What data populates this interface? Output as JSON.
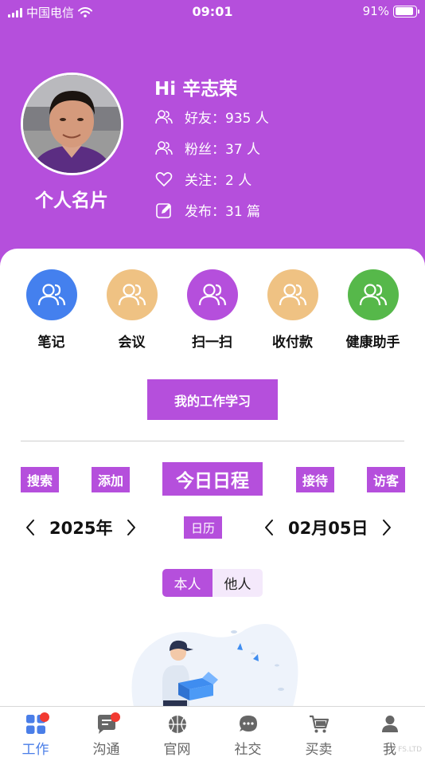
{
  "status_bar": {
    "carrier": "中国电信",
    "time": "09:01",
    "battery": "91%",
    "battery_level": 0.91
  },
  "profile": {
    "greeting": "Hi 辛志荣",
    "card_title": "个人名片",
    "stats": [
      {
        "label": "好友：935 人",
        "icon": "friends-icon"
      },
      {
        "label": "粉丝：37 人",
        "icon": "fans-icon"
      },
      {
        "label": "关注：2 人",
        "icon": "heart-icon"
      },
      {
        "label": "发布：31 篇",
        "icon": "edit-icon"
      }
    ]
  },
  "quick_actions": [
    {
      "label": "笔记",
      "color": "#4480ee"
    },
    {
      "label": "会议",
      "color": "#efc283"
    },
    {
      "label": "扫一扫",
      "color": "#b54fdc"
    },
    {
      "label": "收付款",
      "color": "#efc283"
    },
    {
      "label": "健康助手",
      "color": "#56b84a"
    }
  ],
  "study_button": "我的工作学习",
  "schedule": {
    "search": "搜索",
    "add": "添加",
    "title": "今日日程",
    "reception": "接待",
    "visitor": "访客",
    "year": "2025年",
    "calendar": "日历",
    "date": "02月05日",
    "toggle_self": "本人",
    "toggle_others": "他人"
  },
  "tabbar": [
    {
      "label": "工作",
      "icon": "work-grid-icon",
      "active": true,
      "badge": true
    },
    {
      "label": "沟通",
      "icon": "chat-icon",
      "active": false,
      "badge": true
    },
    {
      "label": "官网",
      "icon": "basketball-icon",
      "active": false,
      "badge": false
    },
    {
      "label": "社交",
      "icon": "message-bubble-icon",
      "active": false,
      "badge": false
    },
    {
      "label": "买卖",
      "icon": "cart-icon",
      "active": false,
      "badge": false
    },
    {
      "label": "我",
      "icon": "person-icon",
      "active": false,
      "badge": false
    }
  ],
  "watermark": "FS.LTD",
  "colors": {
    "brand": "#b54fdc",
    "active_tab": "#4a7ee8",
    "badge": "#f23a31"
  }
}
